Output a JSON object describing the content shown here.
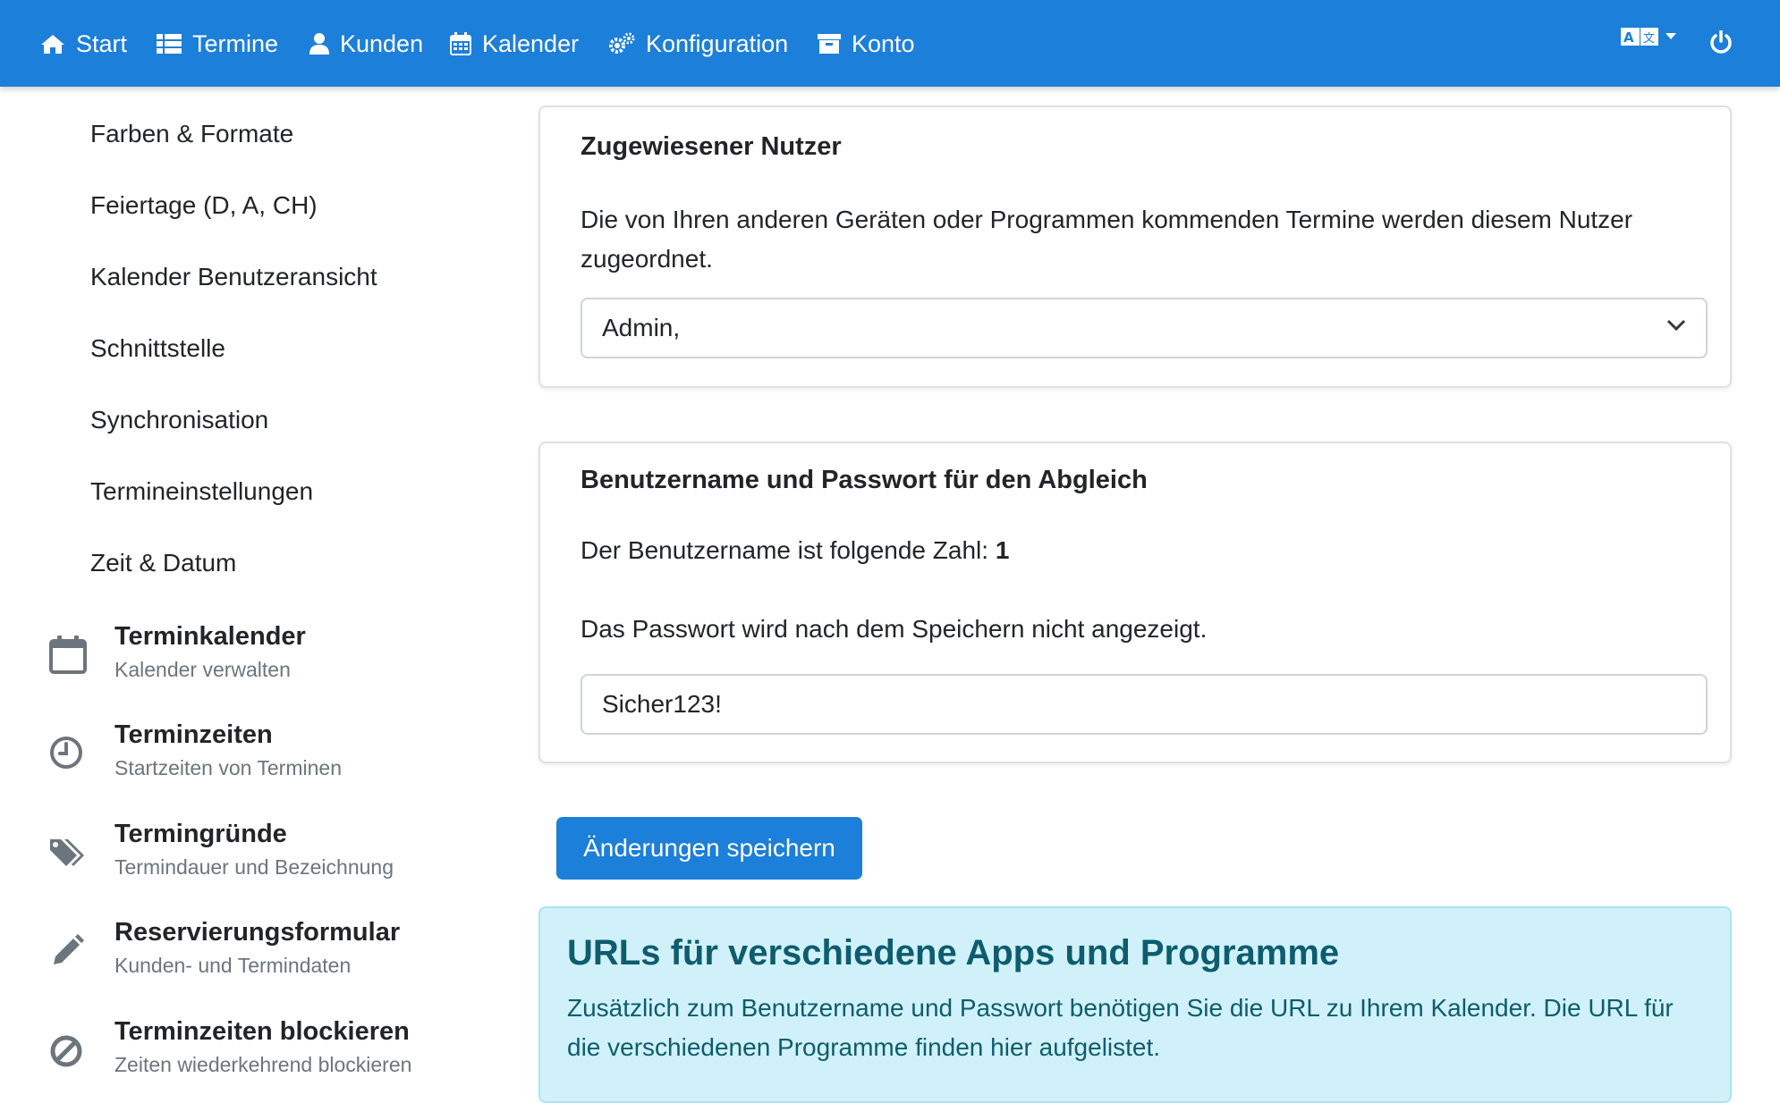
{
  "nav": {
    "items": [
      {
        "label": "Start",
        "icon": "home-icon"
      },
      {
        "label": "Termine",
        "icon": "list-icon"
      },
      {
        "label": "Kunden",
        "icon": "user-icon"
      },
      {
        "label": "Kalender",
        "icon": "calendar-icon"
      },
      {
        "label": "Konfiguration",
        "icon": "gears-icon"
      },
      {
        "label": "Konto",
        "icon": "archive-icon"
      }
    ],
    "language_icon": "language-icon",
    "power_icon": "power-icon"
  },
  "sidebar": {
    "links": [
      "Farben & Formate",
      "Feiertage (D, A, CH)",
      "Kalender Benutzeransicht",
      "Schnittstelle",
      "Synchronisation",
      "Termineinstellungen",
      "Zeit & Datum"
    ],
    "entries": [
      {
        "title": "Terminkalender",
        "subtitle": "Kalender verwalten",
        "icon": "calendar-icon"
      },
      {
        "title": "Terminzeiten",
        "subtitle": "Startzeiten von Terminen",
        "icon": "clock-icon"
      },
      {
        "title": "Termingründe",
        "subtitle": "Termindauer und Bezeichnung",
        "icon": "tags-icon"
      },
      {
        "title": "Reservierungsformular",
        "subtitle": "Kunden- und Termindaten",
        "icon": "pencil-icon"
      },
      {
        "title": "Terminzeiten blockieren",
        "subtitle": "Zeiten wiederkehrend blockieren",
        "icon": "ban-icon"
      }
    ]
  },
  "card_user": {
    "title": "Zugewiesener Nutzer",
    "text": "Die von Ihren anderen Geräten oder Programmen kommenden Termine werden diesem Nutzer zugeordnet.",
    "select_value": "Admin,"
  },
  "card_credentials": {
    "title": "Benutzername und Passwort für den Abgleich",
    "username_text": "Der Benutzername ist folgende Zahl: ",
    "username_value": "1",
    "password_text": "Das Passwort wird nach dem Speichern nicht angezeigt.",
    "password_value": "Sicher123!"
  },
  "save_button": "Änderungen speichern",
  "info": {
    "title": "URLs für verschiedene Apps und Programme",
    "text": "Zusätzlich zum Benutzername und Passwort benötigen Sie die URL zu Ihrem Kalender. Die URL für die verschiedenen Programme finden hier aufgelistet."
  },
  "colors": {
    "primary": "#1c7fd9",
    "info_bg": "#d1f1fa",
    "info_text": "#0d5d6e",
    "muted": "#6c757d"
  }
}
